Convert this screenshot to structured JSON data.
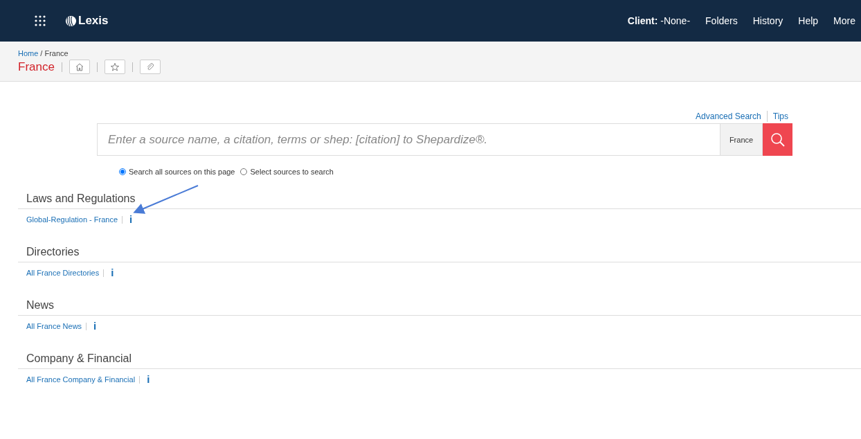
{
  "header": {
    "logo": "Lexis",
    "client_label": "Client:",
    "client_value": "-None-",
    "nav": [
      "Folders",
      "History",
      "Help",
      "More"
    ]
  },
  "breadcrumb": {
    "items": [
      "Home",
      "France"
    ],
    "separator": "/"
  },
  "page_title": "France",
  "search": {
    "links": [
      "Advanced Search",
      "Tips"
    ],
    "placeholder": "Enter a source name, a citation, terms or shep: [citation] to Shepardize®.",
    "scope": "France",
    "options": [
      {
        "label": "Search all sources on this page",
        "selected": true
      },
      {
        "label": "Select sources to search",
        "selected": false
      }
    ]
  },
  "sections": [
    {
      "title": "Laws and Regulations",
      "items": [
        {
          "label": "Global-Regulation - France",
          "info": "i",
          "pointed": true
        }
      ]
    },
    {
      "title": "Directories",
      "items": [
        {
          "label": "All France Directories",
          "info": "i",
          "pointed": false
        }
      ]
    },
    {
      "title": "News",
      "items": [
        {
          "label": "All France News",
          "info": "i",
          "pointed": false
        }
      ]
    },
    {
      "title": "Company & Financial",
      "items": [
        {
          "label": "All France Company & Financial",
          "info": "i",
          "pointed": false
        }
      ]
    }
  ]
}
